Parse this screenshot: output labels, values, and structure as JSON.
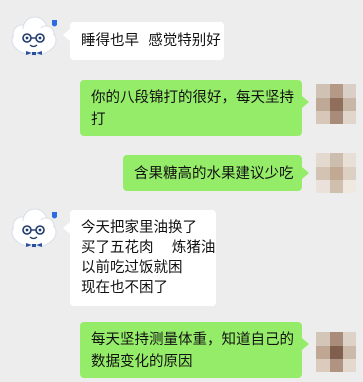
{
  "messages": [
    {
      "side": "in",
      "lines": [
        "睡得也早  感觉特别好"
      ]
    },
    {
      "side": "out",
      "lines": [
        "你的八段锦打的很好，每天坚持",
        "打"
      ]
    },
    {
      "side": "out",
      "lines": [
        "含果糖高的水果建议少吃"
      ]
    },
    {
      "side": "in",
      "lines": [
        "今天把家里油换了",
        "买了五花肉    炼猪油",
        "以前吃过饭就困",
        "现在也不困了"
      ]
    },
    {
      "side": "out",
      "lines": [
        "每天坚持测量体重，知道自己的",
        "数据变化的原因"
      ]
    }
  ]
}
